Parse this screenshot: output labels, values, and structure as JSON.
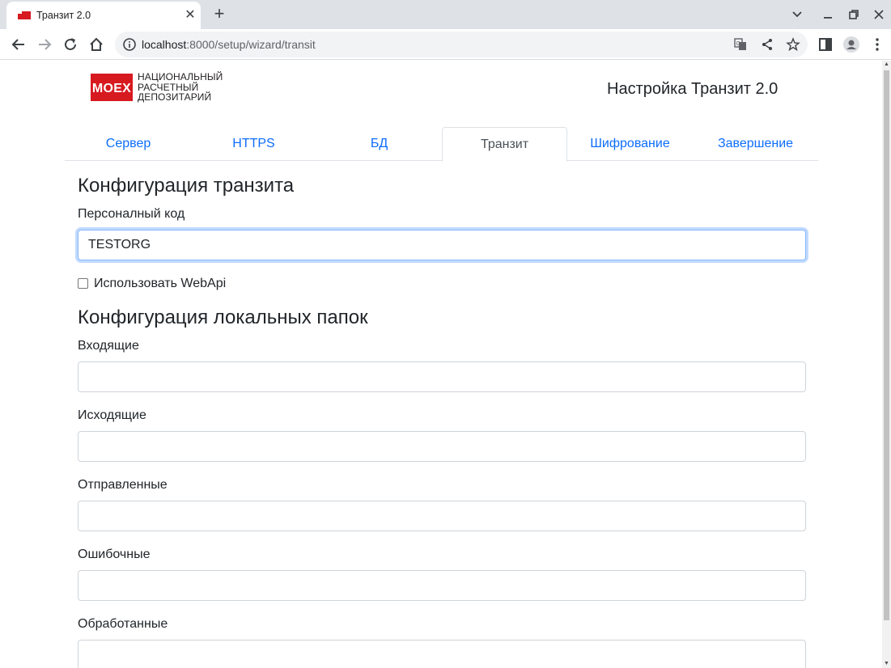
{
  "browser": {
    "tab_title": "Транзит 2.0",
    "url_host": "localhost",
    "url_path": ":8000/setup/wizard/transit"
  },
  "header": {
    "logo_badge": "MOEX",
    "logo_line1": "НАЦИОНАЛЬНЫЙ",
    "logo_line2": "РАСЧЕТНЫЙ",
    "logo_line3": "ДЕПОЗИТАРИЙ",
    "title": "Настройка Транзит 2.0"
  },
  "wizard_tabs": [
    {
      "label": "Сервер",
      "active": false
    },
    {
      "label": "HTTPS",
      "active": false
    },
    {
      "label": "БД",
      "active": false
    },
    {
      "label": "Транзит",
      "active": true
    },
    {
      "label": "Шифрование",
      "active": false
    },
    {
      "label": "Завершение",
      "active": false
    }
  ],
  "transit": {
    "heading": "Конфигурация транзита",
    "personal_code_label": "Персоналный код",
    "personal_code_value": "TESTORG",
    "use_webapi_label": "Использовать WebApi",
    "use_webapi_checked": false
  },
  "local_folders": {
    "heading": "Конфигурация локальных папок",
    "incoming_label": "Входящие",
    "incoming_value": "",
    "outgoing_label": "Исходящие",
    "outgoing_value": "",
    "sent_label": "Отправленные",
    "sent_value": "",
    "error_label": "Ошибочные",
    "error_value": "",
    "processed_label": "Обработанные",
    "processed_value": ""
  },
  "colors": {
    "link": "#0d6efd",
    "brand_red": "#d71920",
    "focus_border": "#86b7fe"
  }
}
